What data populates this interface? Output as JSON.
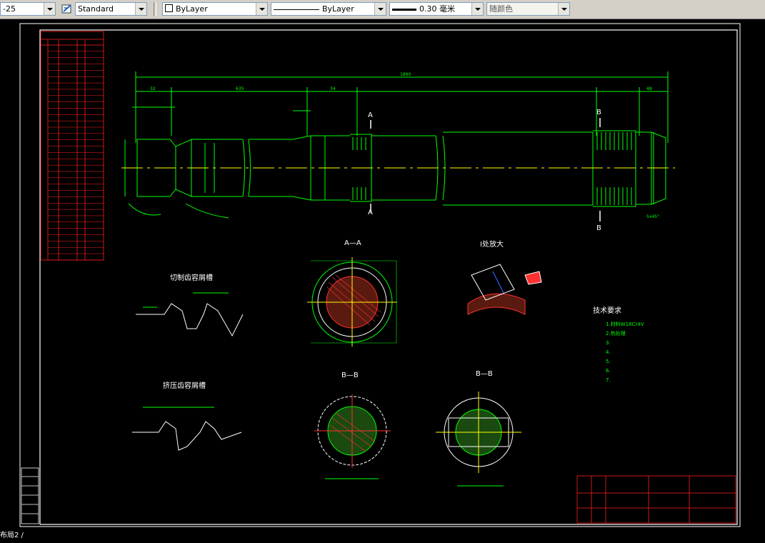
{
  "toolbar": {
    "dimstyle_value": "-25",
    "textstyle_value": "Standard",
    "layer_color_value": "ByLayer",
    "linetype_value": "ByLayer",
    "lineweight_value": "0.30 毫米",
    "plotstyle_value": "随颜色"
  },
  "drawing": {
    "section_aa": "A—A",
    "detail_title": "I处放大",
    "section_bb_left": "B—B",
    "section_bb_right": "B—B",
    "cut_a_top": "A",
    "cut_a_bottom": "A",
    "cut_b_top": "B",
    "cut_b_bottom": "B",
    "spline_title_1": "切制齿容屑槽",
    "spline_title_2": "挤压齿容屑槽",
    "tech_title": "技术要求",
    "tech_items": [
      "1.材料W18Cr4V",
      "2.热处理",
      "3.",
      "4.",
      "5.",
      "6.",
      "7."
    ],
    "dims": {
      "overall": "1890",
      "d1": "32",
      "d2": "635",
      "d3": "34",
      "d4": "48",
      "chamfer": "5x45°"
    }
  },
  "status_label": "布局2 /"
}
